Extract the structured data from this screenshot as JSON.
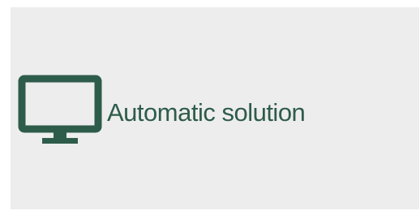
{
  "option": {
    "label": "Automatic solution",
    "icon": "monitor-icon",
    "accent_color": "#2e5c4b",
    "background_color": "#ededed"
  }
}
